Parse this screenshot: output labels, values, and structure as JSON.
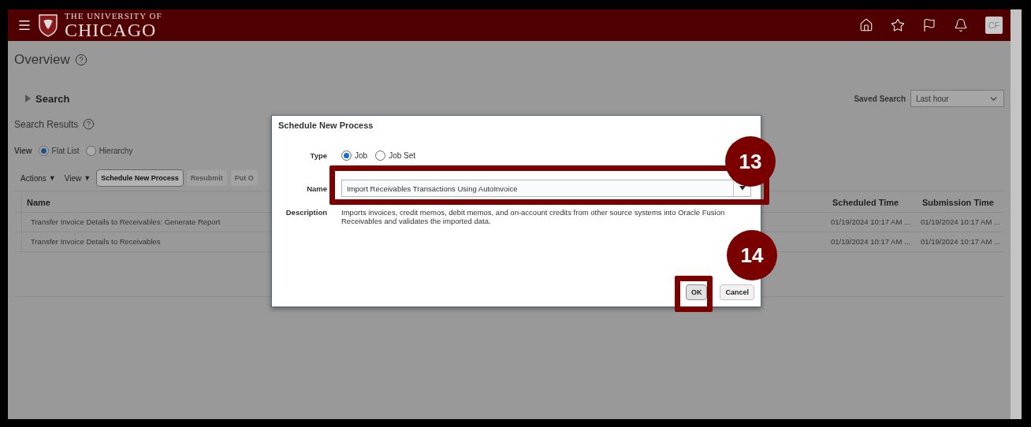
{
  "header": {
    "logo_top": "THE UNIVERSITY OF",
    "logo_main": "CHICAGO",
    "user_initials": "CF"
  },
  "page": {
    "title": "Overview"
  },
  "search": {
    "label": "Search",
    "expanded": false
  },
  "saved_search": {
    "label": "Saved Search",
    "value": "Last hour"
  },
  "results": {
    "title": "Search Results",
    "view_label": "View",
    "view_options": [
      {
        "label": "Flat List",
        "selected": true
      },
      {
        "label": "Hierarchy",
        "selected": false
      }
    ]
  },
  "toolbar": [
    {
      "label": "Actions",
      "kind": "menu",
      "disabled": false,
      "icon": "▼"
    },
    {
      "label": "View",
      "kind": "menu",
      "disabled": false,
      "icon": "▼"
    },
    {
      "label": "Schedule New Process",
      "kind": "button",
      "disabled": false
    },
    {
      "label": "Resubmit",
      "kind": "button",
      "disabled": true
    },
    {
      "label": "Put O",
      "kind": "button",
      "disabled": true
    }
  ],
  "table": {
    "columns": [
      "Name",
      "Scheduled Time",
      "Submission Time"
    ],
    "rows": [
      {
        "name": "Transfer Invoice Details to Receivables: Generate Report",
        "scheduled_time": "01/19/2024 10:17 AM ...",
        "submission_time": "01/19/2024 10:17 AM ..."
      },
      {
        "name": "Transfer Invoice Details to Receivables",
        "scheduled_time": "01/19/2024 10:17 AM ...",
        "submission_time": "01/19/2024 10:17 AM ..."
      }
    ]
  },
  "dialog": {
    "title": "Schedule New Process",
    "type_label": "Type",
    "type_options": [
      {
        "label": "Job",
        "selected": true
      },
      {
        "label": "Job Set",
        "selected": false
      }
    ],
    "name_label": "Name",
    "name_value": "Import Receivables Transactions Using AutoInvoice",
    "description_label": "Description",
    "description": "Imports invoices, credit memos, debit memos, and on-account credits from other source systems into Oracle Fusion Receivables and validates the imported data.",
    "buttons": [
      {
        "label": "OK",
        "kind": "primary"
      },
      {
        "label": "Cancel",
        "kind": "secondary"
      }
    ]
  },
  "callouts": [
    {
      "number": "13"
    },
    {
      "number": "14"
    }
  ]
}
